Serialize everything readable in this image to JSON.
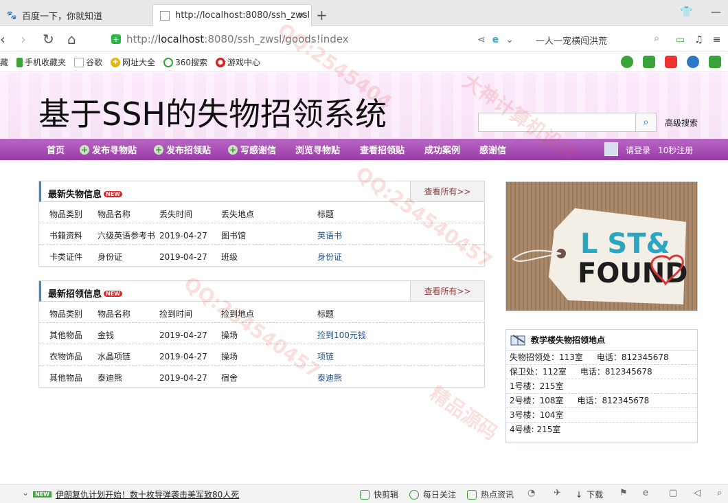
{
  "browser": {
    "tabs": [
      {
        "title": "百度一下，你就知道"
      },
      {
        "title": "http://localhost:8080/ssh_zwsl"
      }
    ],
    "url_prefix": "http://",
    "url_host": "localhost",
    "url_rest": ":8080/ssh_zwsl/goods!index",
    "search_text": "一人一宠横闯洪荒",
    "bookmarks": [
      "藏",
      "手机收藏夹",
      "谷歌",
      "网址大全",
      "360搜索",
      "游戏中心"
    ]
  },
  "site": {
    "title": "基于SSH的失物招领系统",
    "search_placeholder": "",
    "advanced_search": "高级搜索",
    "nav": [
      "首页",
      "发布寻物贴",
      "发布招领贴",
      "写感谢信",
      "浏览寻物贴",
      "查看招领贴",
      "成功案例",
      "感谢信"
    ],
    "login": "请登录",
    "register": "10秒注册"
  },
  "lost_panel": {
    "title": "最新失物信息",
    "badge": "NEW",
    "more": "查看所有>>",
    "columns": [
      "物品类别",
      "物品名称",
      "丢失时间",
      "丢失地点",
      "标题"
    ],
    "rows": [
      [
        "书籍资料",
        "六级英语参考书",
        "2019-04-27",
        "图书馆",
        "英语书"
      ],
      [
        "卡类证件",
        "身份证",
        "2019-04-27",
        "班级",
        "身份证"
      ]
    ]
  },
  "found_panel": {
    "title": "最新招领信息",
    "badge": "NEW",
    "more": "查看所有>>",
    "columns": [
      "物品类别",
      "物品名称",
      "捡到时间",
      "捡到地点",
      "标题"
    ],
    "rows": [
      [
        "其他物品",
        "金钱",
        "2019-04-27",
        "操场",
        "捡到100元钱"
      ],
      [
        "衣物饰品",
        "水晶项链",
        "2019-04-27",
        "操场",
        "项链"
      ],
      [
        "其他物品",
        "泰迪熊",
        "2019-04-27",
        "宿舍",
        "泰迪熊"
      ]
    ]
  },
  "image": {
    "tag_line1": "L  ST&",
    "tag_line2": "FOUND"
  },
  "locations": {
    "title": "教学楼失物招领地点",
    "lines": [
      {
        "text": "失物招领处：113室",
        "phone": "电话：812345678"
      },
      {
        "text": "保卫处：112室",
        "phone": "电话：812345678"
      },
      {
        "text": "1号楼：215室",
        "phone": ""
      },
      {
        "text": "2号楼：108室",
        "phone": "电话：812345678"
      },
      {
        "text": "3号楼：104室",
        "phone": ""
      },
      {
        "text": "4号楼: 215室",
        "phone": ""
      }
    ]
  },
  "statusbar": {
    "news_badge": "NEW",
    "news": "伊朗复仇计划开始！数十枚导弹袭击美军致80人死",
    "items": [
      "快剪辑",
      "每日关注",
      "热点资讯",
      "下载"
    ]
  },
  "watermarks": [
    "QQ:2545404",
    "大神计算机设计",
    "QQ:254540457",
    "精品源码"
  ],
  "colors": {
    "nav_purple": "#a64db3",
    "link_blue": "#1f4f8a",
    "accent_bar": "#3b89c8"
  }
}
